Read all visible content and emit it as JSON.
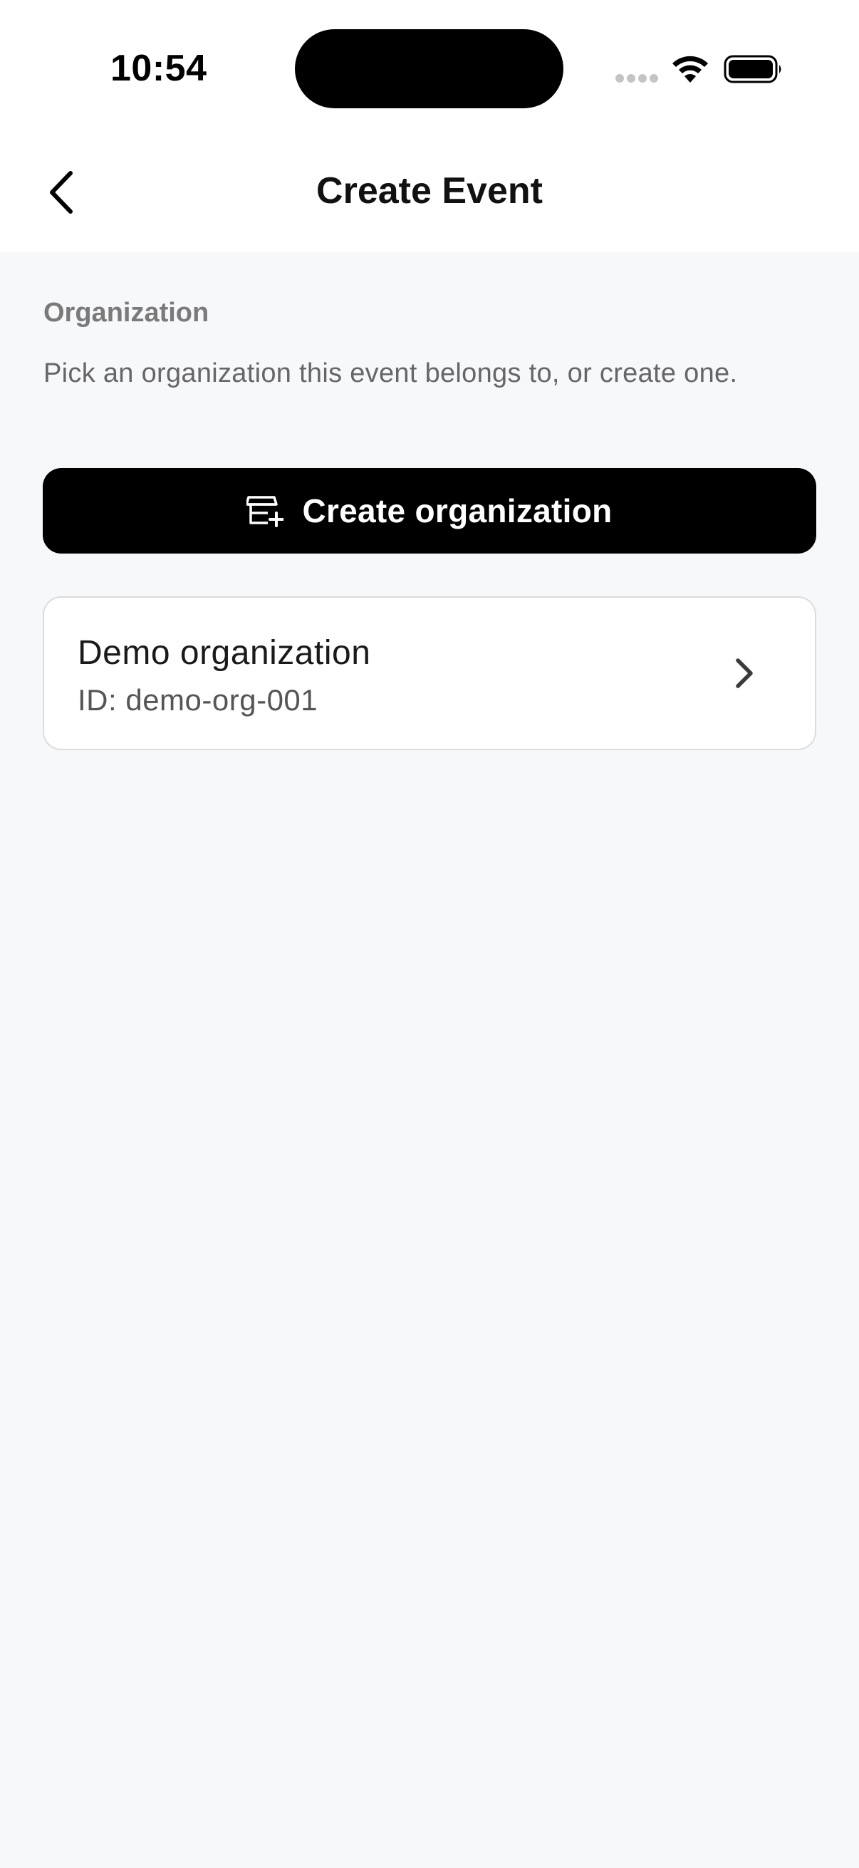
{
  "status_bar": {
    "time": "10:54"
  },
  "header": {
    "title": "Create Event",
    "back_icon": "chevron-left-icon"
  },
  "organization_section": {
    "label": "Organization",
    "description": "Pick an organization this event belongs to, or create one.",
    "create_button": {
      "label": "Create organization",
      "icon": "store-plus-icon"
    },
    "organizations": [
      {
        "name": "Demo organization",
        "id_text": "ID: demo-org-001"
      }
    ]
  },
  "colors": {
    "background": "#f7f8fa",
    "header_background": "#ffffff",
    "primary_button": "#000000",
    "card_border": "#dcdcdc",
    "label_gray": "#7a7a7a"
  }
}
